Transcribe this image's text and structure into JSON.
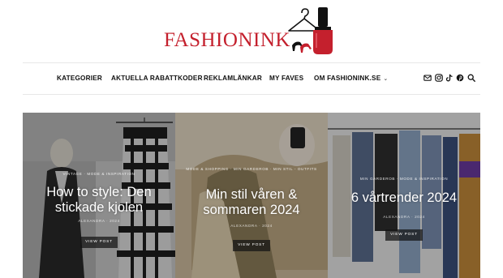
{
  "logo": {
    "text": "FASHIONINK",
    "brand_color": "#c4202d"
  },
  "nav": {
    "items": [
      {
        "label": "KATEGORIER"
      },
      {
        "label": "AKTUELLA RABATTKODER"
      },
      {
        "label": "REKLAMLÄNKAR"
      },
      {
        "label": "MY FAVES"
      },
      {
        "label": "OM FASHIONINK.SE",
        "has_dropdown": true
      }
    ],
    "icons": [
      "mail-icon",
      "instagram-icon",
      "tiktok-icon",
      "pinterest-icon",
      "search-icon"
    ]
  },
  "posts": [
    {
      "categories": "Vintage · Mode & inspiration",
      "title": "How to style: Den stickade kjolen",
      "meta": "Alexandra · 2024",
      "button": "View Post"
    },
    {
      "categories": "Mode & shopping · Min garderob · Min stil - outfits",
      "title": "Min stil våren & sommaren 2024",
      "meta": "Alexandra · 2024",
      "button": "View Post"
    },
    {
      "categories": "Min garderob · Mode & inspiration",
      "title": "6 vårtrender 2024",
      "meta": "Alexandra · 2024",
      "button": "View Post"
    }
  ]
}
